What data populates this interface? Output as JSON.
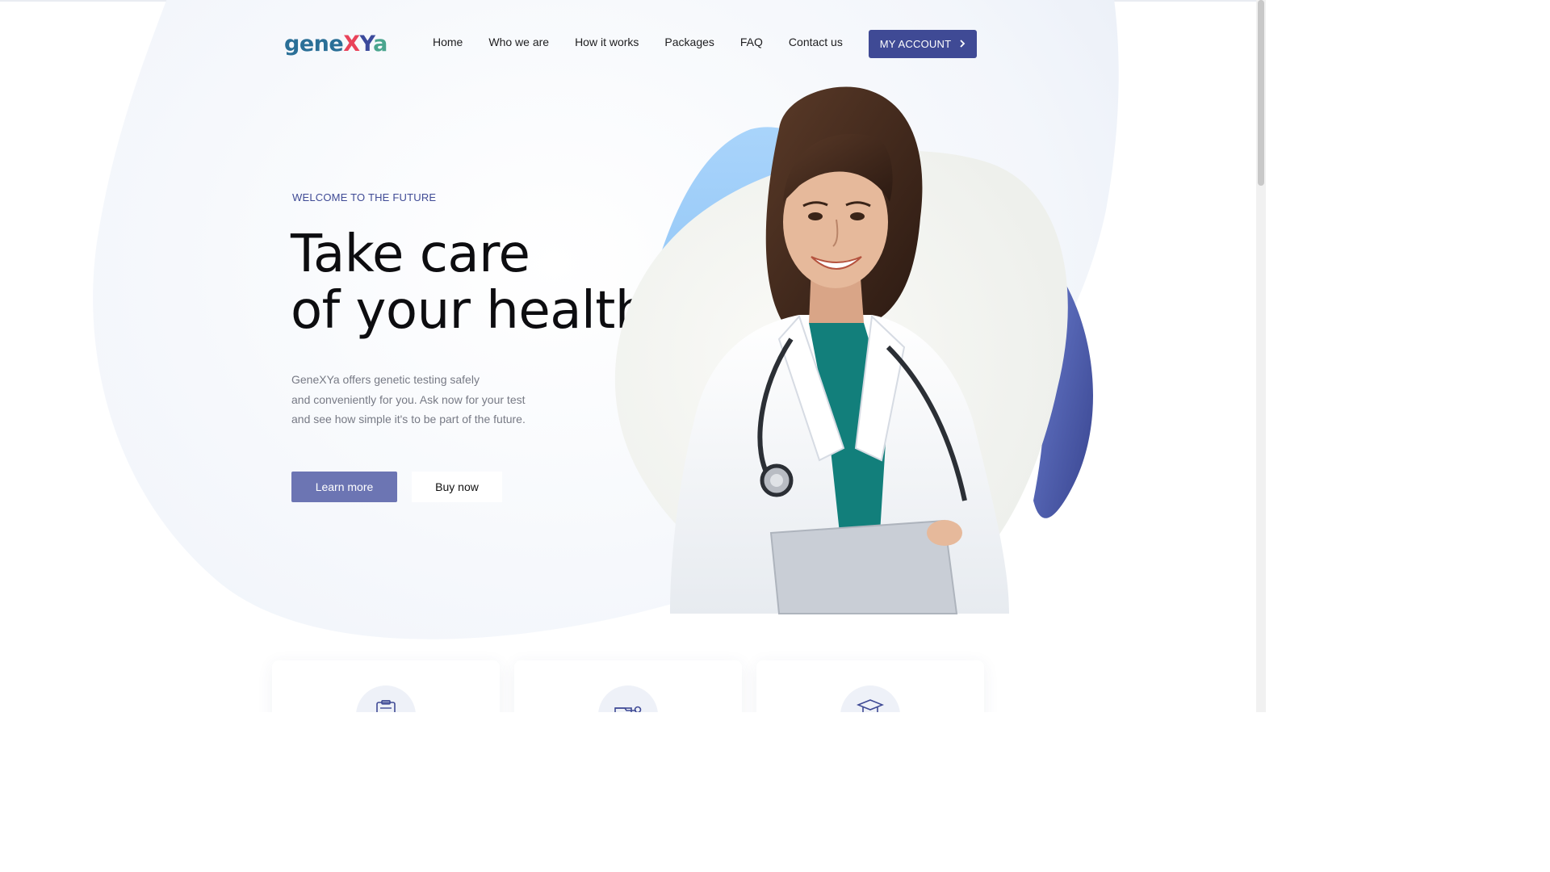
{
  "brand": {
    "logo_text_1": "gene",
    "logo_text_x": "X",
    "logo_text_y": "Y",
    "logo_text_a": "a",
    "colors": {
      "primary": "#3f4a95",
      "primary_light": "#6c75b3",
      "accent_blue": "#8ec5f5",
      "teal": "#4aa58e",
      "red": "#e9435a"
    }
  },
  "nav": {
    "items": [
      {
        "label": "Home"
      },
      {
        "label": "Who we are"
      },
      {
        "label": "How it works"
      },
      {
        "label": "Packages"
      },
      {
        "label": "FAQ"
      },
      {
        "label": "Contact us"
      }
    ],
    "account_label": "MY ACCOUNT",
    "account_icon": "chevron-right-icon"
  },
  "hero": {
    "eyebrow": "WELCOME TO THE FUTURE",
    "headline_line1": "Take care",
    "headline_line2": "of your health",
    "description_line1": "GeneXYa offers genetic testing safely",
    "description_line2": "and conveniently for you. Ask now for your test",
    "description_line3": "and see how simple it's to be part of the future.",
    "learn_more_label": "Learn more",
    "buy_now_label": "Buy now",
    "image_subject": "smiling doctor with stethoscope and tablet"
  },
  "cards": [
    {
      "icon": "clipboard-icon"
    },
    {
      "icon": "microscope-icon"
    },
    {
      "icon": "graduation-cap-icon"
    }
  ]
}
